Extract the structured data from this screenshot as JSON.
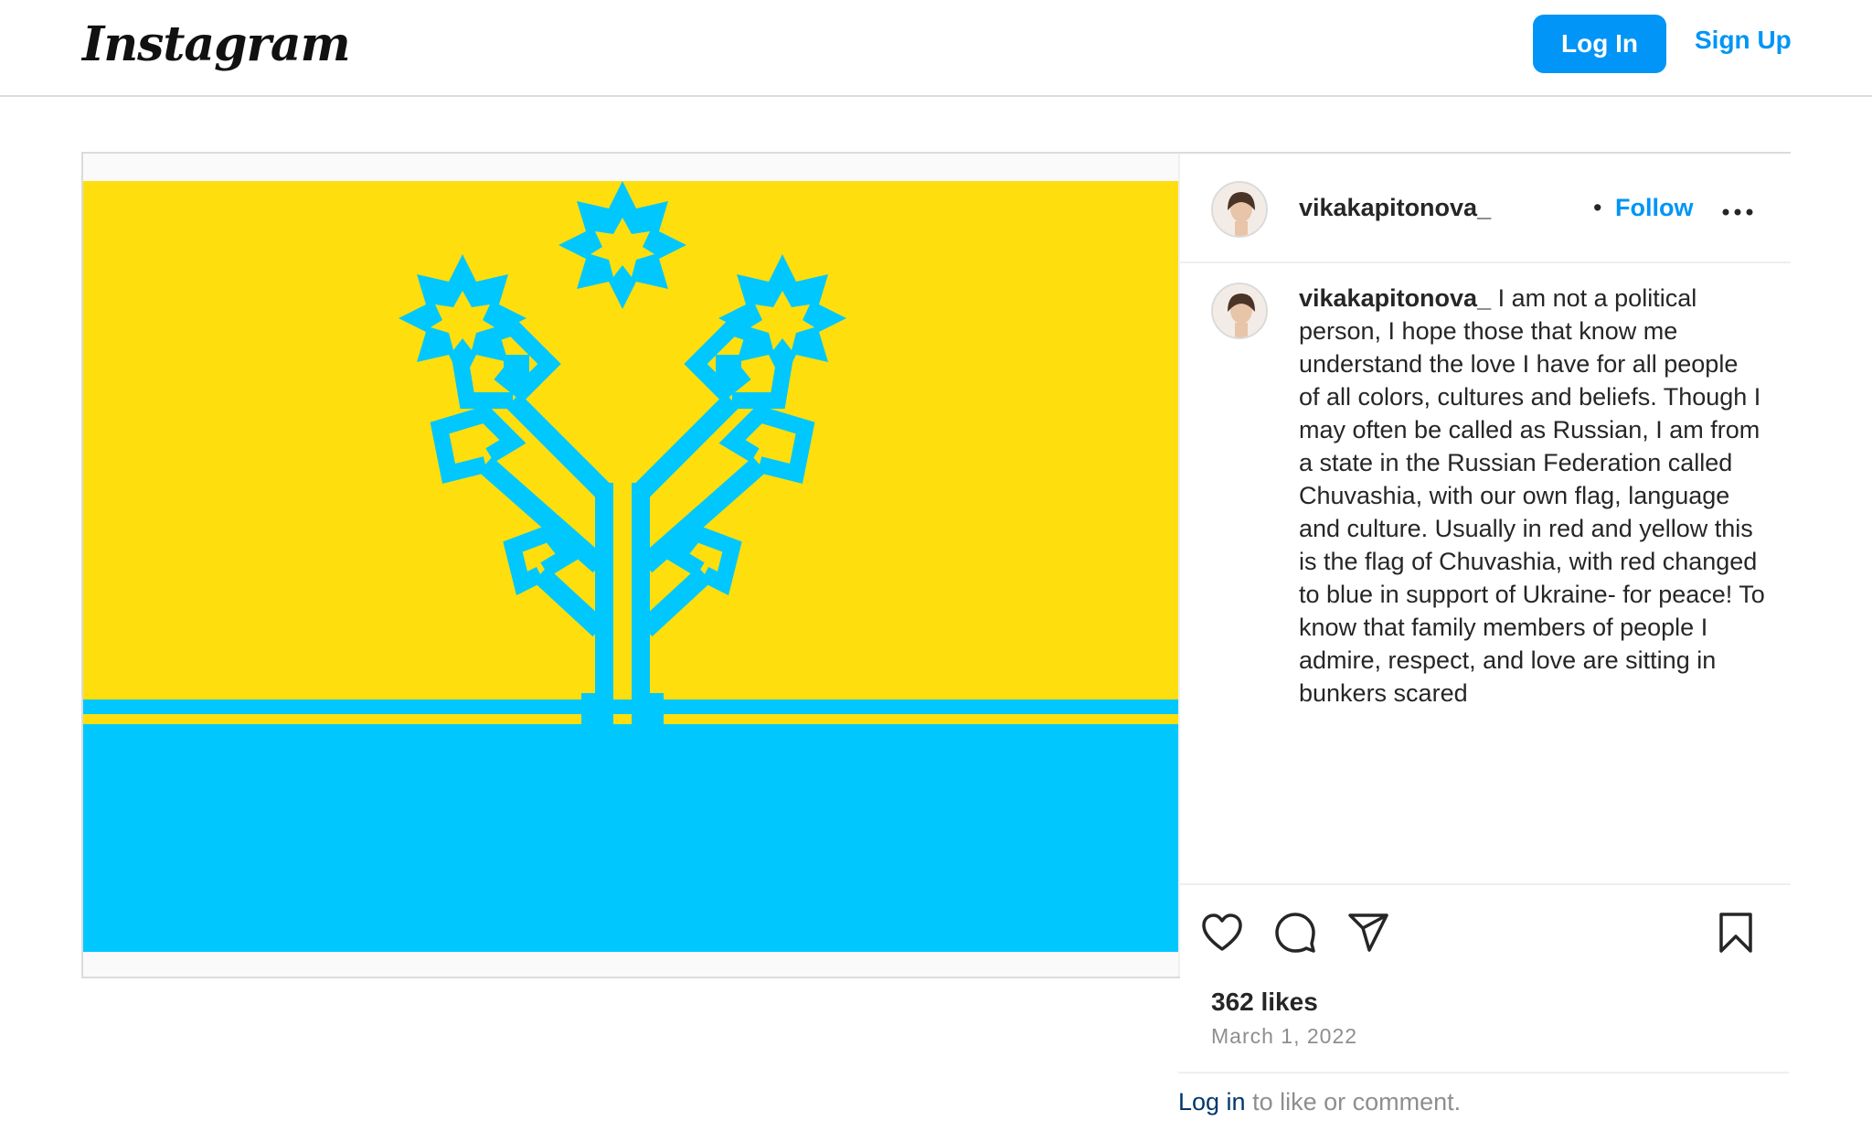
{
  "header": {
    "logo": "Instagram",
    "login_label": "Log In",
    "signup_label": "Sign Up"
  },
  "post": {
    "username": "vikakapitonova_",
    "separator": "•",
    "follow_label": "Follow",
    "caption_username": "vikakapitonova_",
    "caption_text": " I am not a political person, I hope those that know me understand the love I have for all people of all colors, cultures and beliefs. Though I may often be called as Russian, I am from a state in the Russian Federation called Chuvashia, with our own flag, language and culture. Usually in red and yellow this is the flag of Chuvashia, with red changed to blue in support of Ukraine- for peace! To know that family members of people I admire, respect, and love are sitting in bunkers scared",
    "likes": "362 likes",
    "date": "March 1, 2022",
    "login_link": "Log in",
    "login_suffix": " to like or comment."
  },
  "colors": {
    "brand_blue": "#0095f6",
    "flag_yellow": "#ffde0e",
    "flag_blue": "#00c8ff"
  },
  "icons": [
    "more-options-icon",
    "heart-icon",
    "comment-icon",
    "share-icon",
    "bookmark-icon"
  ]
}
